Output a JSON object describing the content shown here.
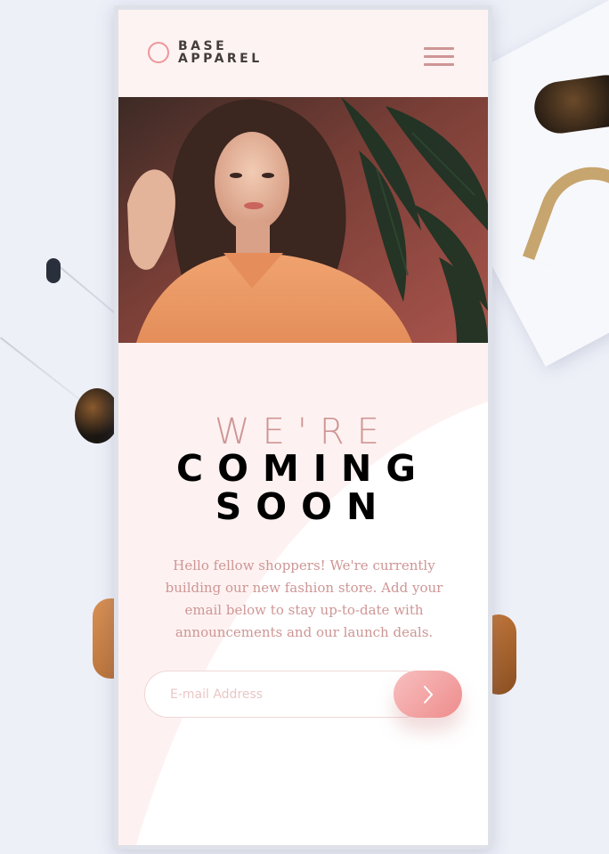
{
  "brand": {
    "line1": "BASE",
    "line2": "APPAREL",
    "accent_color": "#ef959a",
    "text_color": "#433c3c"
  },
  "header": {
    "menu_icon": "hamburger-menu-icon"
  },
  "hero": {
    "image_alt": "Woman in a peach shirt in front of a pink wall and plants"
  },
  "headline": {
    "light": "WE'RE",
    "bold_line1": "COMING",
    "bold_line2": "SOON"
  },
  "description": "Hello fellow shoppers! We're currently building our new fashion store. Add your email below to stay up-to-date with announcements and our launch deals.",
  "form": {
    "email_placeholder": "E-mail Address",
    "email_value": "",
    "submit_icon": "arrow-right-icon"
  },
  "colors": {
    "desaturated_red": "#ce9695",
    "soft_red": "#f96464",
    "dark_grayish_red": "#423a3a",
    "button_gradient_start": "#f8bfbf",
    "button_gradient_end": "#ee8c8c",
    "header_bg": "#fdf3f2"
  }
}
